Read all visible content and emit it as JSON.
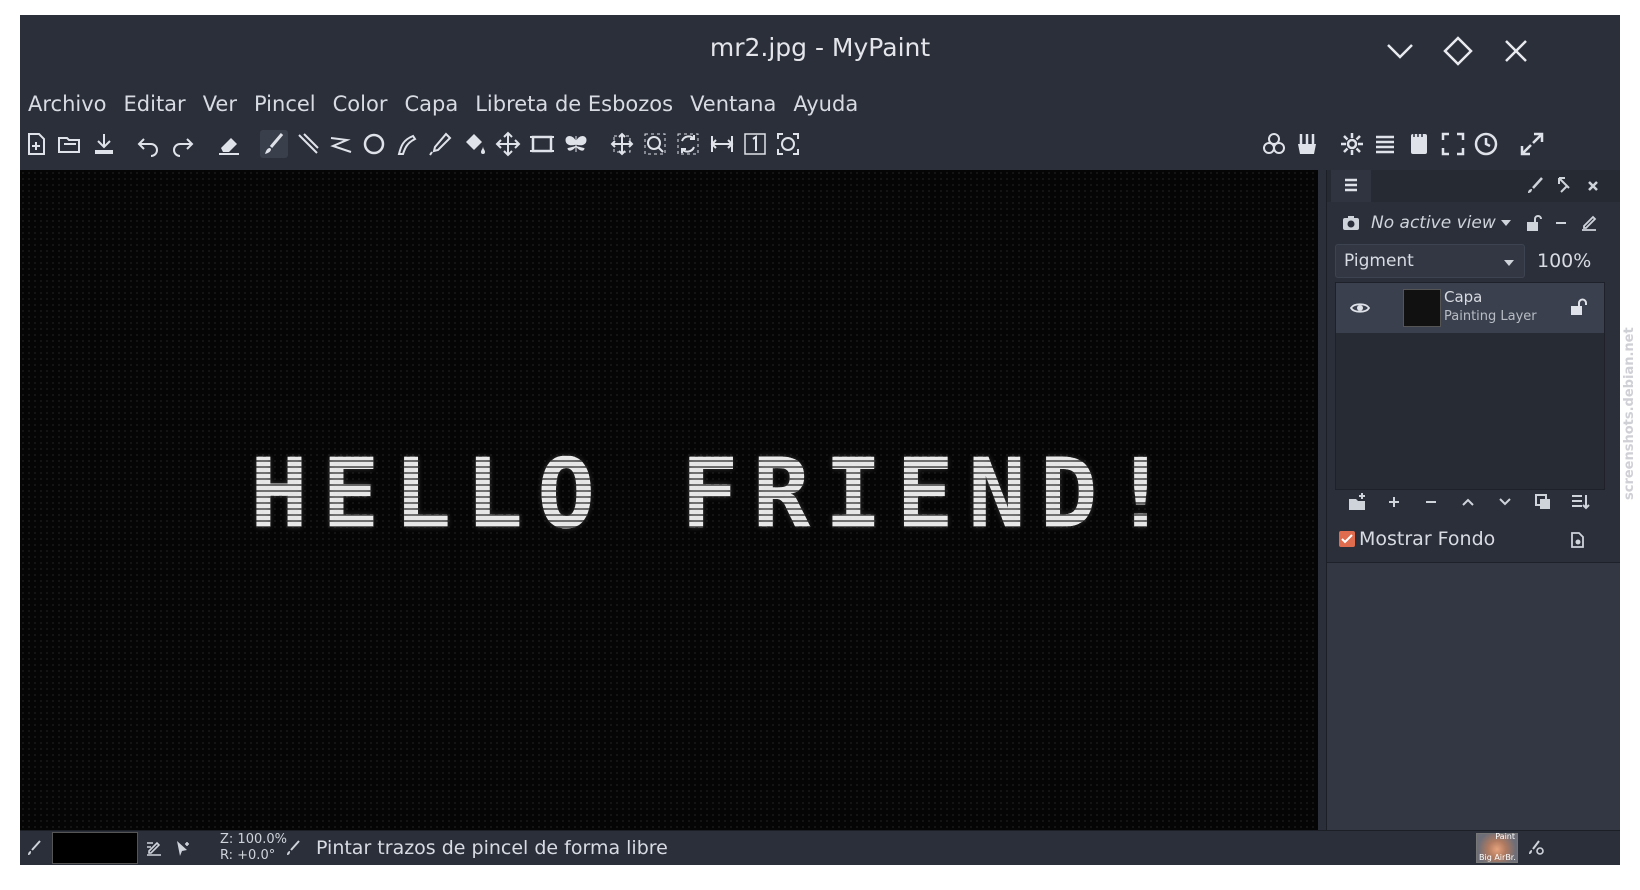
{
  "window": {
    "title": "mr2.jpg - MyPaint"
  },
  "window_controls": [
    "minimize",
    "maximize",
    "close"
  ],
  "menu": [
    "Archivo",
    "Editar",
    "Ver",
    "Pincel",
    "Color",
    "Capa",
    "Libreta de Esbozos",
    "Ventana",
    "Ayuda"
  ],
  "toolbar": {
    "left_icons": [
      "new-document-icon",
      "open-icon",
      "save-icon",
      "undo-icon",
      "redo-icon",
      "eraser-icon",
      "brush-icon",
      "lines-icon",
      "connected-lines-icon",
      "ellipse-icon",
      "inking-icon",
      "color-picker-icon",
      "fill-icon",
      "pan-icon",
      "frame-icon",
      "symmetry-icon"
    ],
    "view_icons": [
      "move-view-icon",
      "zoom-view-icon",
      "rotate-view-icon",
      "mirror-view-icon",
      "reset-view-icon",
      "fit-view-icon"
    ],
    "right_icons": [
      "color-wheel-icon",
      "brushes-icon",
      "settings-icon",
      "layers-icon",
      "scratchpad-icon",
      "fullscreen-icon",
      "history-icon",
      "expand-icon"
    ]
  },
  "canvas": {
    "text": "HELLO FRIEND!"
  },
  "panel": {
    "view_selector": "No active view",
    "blend_mode": "Pigment",
    "opacity": "100%",
    "layers": [
      {
        "name": "Capa",
        "type": "Painting Layer"
      }
    ],
    "show_background_label": "Mostrar Fondo",
    "show_background_checked": true
  },
  "statusbar": {
    "zoom": "Z: 100.0%",
    "rotation": "R: +0.0°",
    "message": "Pintar trazos de pincel de forma libre",
    "brush_label_top": "Paint",
    "brush_label_bottom": "Big AirBr."
  },
  "watermark": "screenshots.debian.net"
}
